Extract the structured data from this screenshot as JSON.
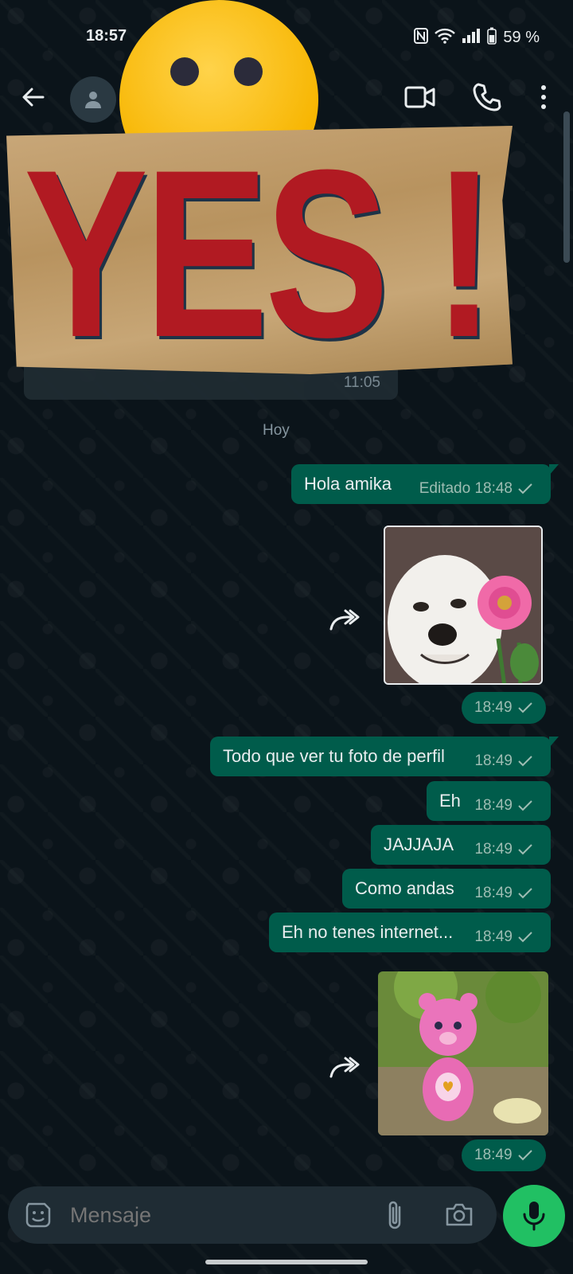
{
  "status_bar": {
    "time": "18:57",
    "battery": "59 %"
  },
  "sticker": {
    "text": "YES !"
  },
  "hidden_message": {
    "time": "11:05"
  },
  "date_separator": "Hoy",
  "messages": [
    {
      "text": "Hola amika",
      "meta": "Editado 18:48"
    },
    {
      "time": "18:49"
    },
    {
      "text": "Todo que ver tu foto de perfil",
      "meta": "18:49"
    },
    {
      "text": "Eh",
      "meta": "18:49"
    },
    {
      "text": "JAJJAJA",
      "meta": "18:49"
    },
    {
      "text": "Como andas",
      "meta": "18:49"
    },
    {
      "text": "Eh no tenes internet...",
      "meta": "18:49"
    },
    {
      "time": "18:49"
    }
  ],
  "input": {
    "placeholder": "Mensaje"
  },
  "colors": {
    "background": "#0b141a",
    "outgoing_bubble": "#005c4b",
    "accent": "#21c063"
  }
}
